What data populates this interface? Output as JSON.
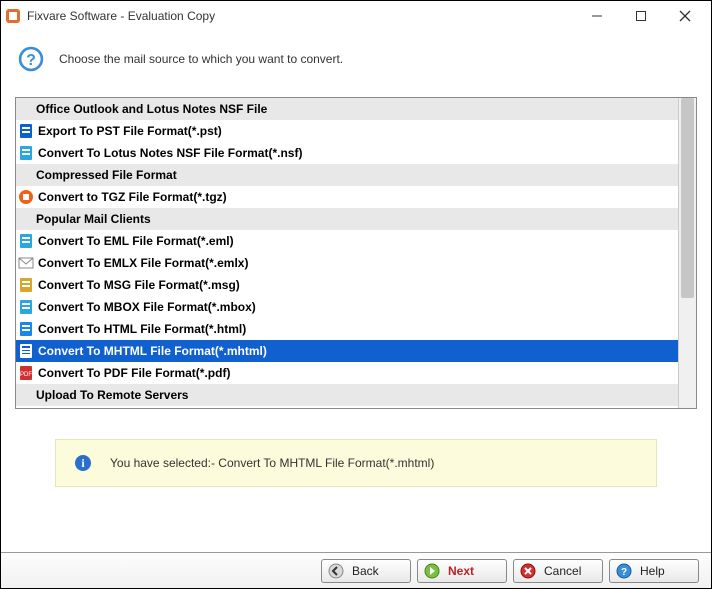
{
  "window": {
    "title": "Fixvare Software - Evaluation Copy"
  },
  "header": {
    "text": "Choose the mail source to which you want to convert."
  },
  "list": {
    "items": [
      {
        "type": "header",
        "label": "Office Outlook and Lotus Notes NSF File"
      },
      {
        "type": "item",
        "icon": "outlook",
        "label": "Export To PST File Format(*.pst)"
      },
      {
        "type": "item",
        "icon": "lotus",
        "label": "Convert To Lotus Notes NSF File Format(*.nsf)"
      },
      {
        "type": "header",
        "label": "Compressed File Format"
      },
      {
        "type": "item",
        "icon": "tgz",
        "label": "Convert to TGZ File Format(*.tgz)"
      },
      {
        "type": "header",
        "label": "Popular Mail Clients"
      },
      {
        "type": "item",
        "icon": "eml",
        "label": "Convert To EML File Format(*.eml)"
      },
      {
        "type": "item",
        "icon": "emlx",
        "label": "Convert To EMLX File Format(*.emlx)"
      },
      {
        "type": "item",
        "icon": "msg",
        "label": "Convert To MSG File Format(*.msg)"
      },
      {
        "type": "item",
        "icon": "mbox",
        "label": "Convert To MBOX File Format(*.mbox)"
      },
      {
        "type": "item",
        "icon": "html",
        "label": "Convert To HTML File Format(*.html)"
      },
      {
        "type": "item",
        "icon": "mhtml",
        "label": "Convert To MHTML File Format(*.mhtml)",
        "selected": true
      },
      {
        "type": "item",
        "icon": "pdf",
        "label": "Convert To PDF File Format(*.pdf)"
      },
      {
        "type": "header",
        "label": "Upload To Remote Servers"
      }
    ]
  },
  "status": {
    "text": "You have selected:- Convert To MHTML File Format(*.mhtml)"
  },
  "footer": {
    "back": "Back",
    "next": "Next",
    "cancel": "Cancel",
    "help": "Help"
  },
  "icons": {
    "outlook": "#0b63c9",
    "lotus": "#2aa7e0",
    "tgz": "#f06018",
    "eml": "#2aa7e0",
    "emlx": "#888",
    "msg": "#d8a62a",
    "mbox": "#2aa7e0",
    "html": "#1a88e8",
    "mhtml": "#fff",
    "pdf": "#d03030"
  }
}
